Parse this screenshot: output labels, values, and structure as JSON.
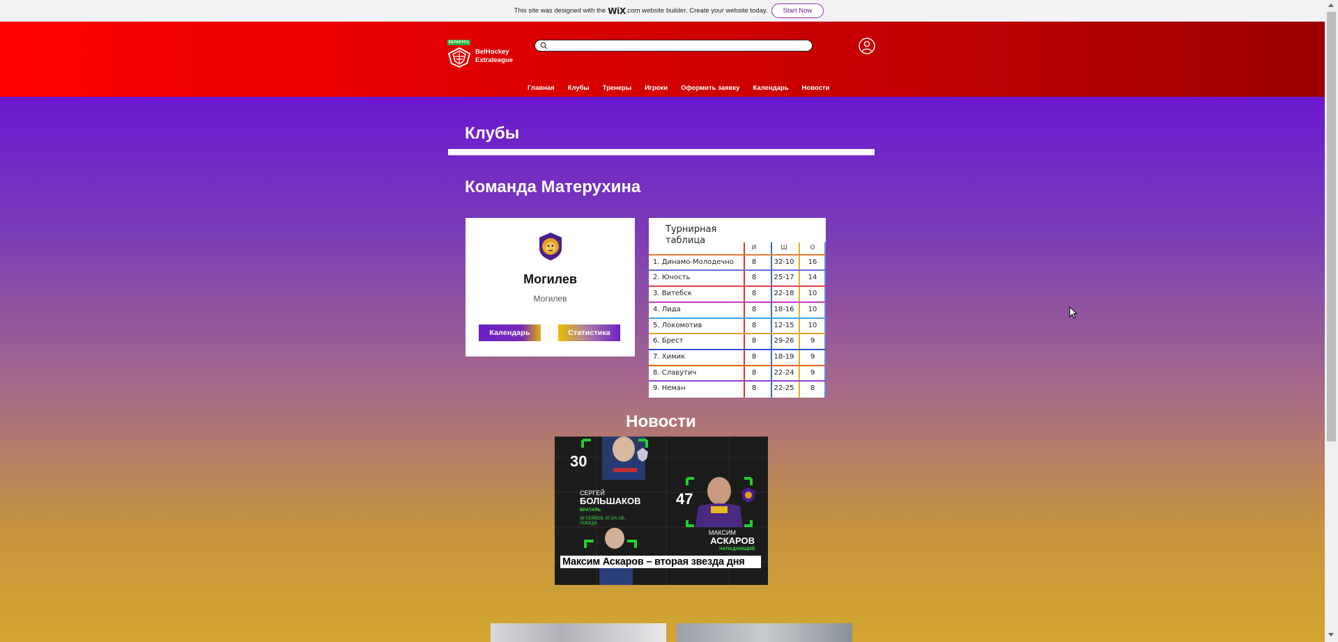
{
  "banner": {
    "text_before": "This site was designed with the",
    "brand": "WiX",
    "text_after": ".com website builder. Create your website today.",
    "button": "Start Now"
  },
  "header": {
    "logo_flag": "БЕЛАРУСЬ",
    "logo_line1": "BelHockey",
    "logo_line2": "Extraleague",
    "search_placeholder": "",
    "nav": [
      "Главная",
      "Клубы",
      "Тренеры",
      "Игроки",
      "Оформить заявку",
      "Календарь",
      "Новости"
    ]
  },
  "page": {
    "title": "Клубы",
    "team_title": "Команда Матерухина"
  },
  "club": {
    "name": "Могилев",
    "city": "Могилев",
    "calendar_button": "Календарь",
    "stats_button": "Статистика"
  },
  "standings": {
    "title_line1": "Турнирная",
    "title_line2": "таблица",
    "columns": [
      "И",
      "Ш",
      "О"
    ],
    "rows": [
      {
        "team": "1. Динамо-Молодечно",
        "games": "8",
        "goals": "32-10",
        "points": "16"
      },
      {
        "team": "2. Юность",
        "games": "8",
        "goals": "25-17",
        "points": "14"
      },
      {
        "team": "3. Витебск",
        "games": "8",
        "goals": "22-18",
        "points": "10"
      },
      {
        "team": "4. Лида",
        "games": "8",
        "goals": "18-16",
        "points": "10"
      },
      {
        "team": "5. Локомотив",
        "games": "8",
        "goals": "12-15",
        "points": "10"
      },
      {
        "team": "6. Брест",
        "games": "8",
        "goals": "29-26",
        "points": "9"
      },
      {
        "team": "7. Химик",
        "games": "8",
        "goals": "18-19",
        "points": "9"
      },
      {
        "team": "8. Славутич",
        "games": "8",
        "goals": "22-24",
        "points": "9"
      },
      {
        "team": "9. Неман",
        "games": "8",
        "goals": "22-25",
        "points": "8"
      }
    ]
  },
  "news": {
    "title": "Новости",
    "caption": "Максим Аскаров – вторая звезда дня",
    "image_text": {
      "num1": "30",
      "player1_first": "СЕРГЕЙ",
      "player1_last": "БОЛЬШАКОВ",
      "player1_pos": "ВРАТАРЬ",
      "player1_stats": "38 СЕЙВОВ, 97,3% ОБ,",
      "player1_stats2": "ПОБЕДА",
      "num2": "47",
      "player2_first": "МАКСИМ",
      "player2_last": "АСКАРОВ",
      "player2_pos": "НАПАДАЮЩИЙ"
    }
  },
  "colors": {
    "header_red": "#e00000",
    "purple": "#6a20c8",
    "gold": "#d2a630"
  }
}
